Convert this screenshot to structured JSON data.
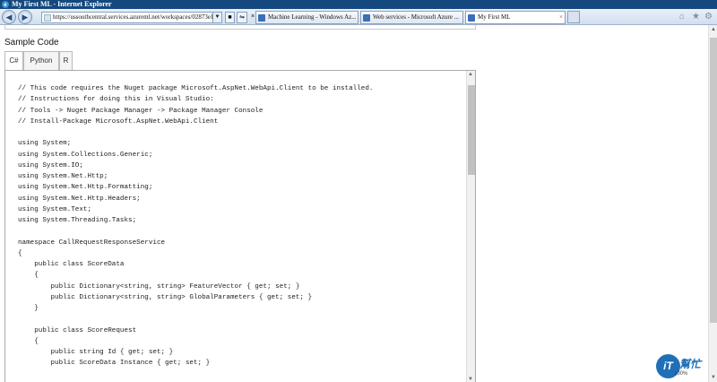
{
  "window": {
    "title": "My First ML - Internet Explorer"
  },
  "browser": {
    "address": "https://ussouthcentral.services.azureml.net/workspaces/02873e1",
    "tabs": [
      {
        "label": "Machine Learning - Windows Az...",
        "active": false
      },
      {
        "label": "Web services - Microsoft Azure ...",
        "active": false
      },
      {
        "label": "My First ML",
        "active": true
      }
    ]
  },
  "page": {
    "heading": "Sample Code",
    "code_tabs": [
      "C#",
      "Python",
      "R"
    ],
    "code_lines": [
      "// This code requires the Nuget package Microsoft.AspNet.WebApi.Client to be installed.",
      "// Instructions for doing this in Visual Studio:",
      "// Tools -> Nuget Package Manager -> Package Manager Console",
      "// Install-Package Microsoft.AspNet.WebApi.Client",
      "",
      "using System;",
      "using System.Collections.Generic;",
      "using System.IO;",
      "using System.Net.Http;",
      "using System.Net.Http.Formatting;",
      "using System.Net.Http.Headers;",
      "using System.Text;",
      "using System.Threading.Tasks;",
      "",
      "namespace CallRequestResponseService",
      "{",
      "    public class ScoreData",
      "    {",
      "        public Dictionary<string, string> FeatureVector { get; set; }",
      "        public Dictionary<string, string> GlobalParameters { get; set; }",
      "    }",
      "",
      "    public class ScoreRequest",
      "    {",
      "        public string Id { get; set; }",
      "        public ScoreData Instance { get; set; }"
    ]
  },
  "watermark": {
    "text": "幫忙",
    "logo": "iT"
  },
  "status": {
    "zoom": "100%"
  }
}
